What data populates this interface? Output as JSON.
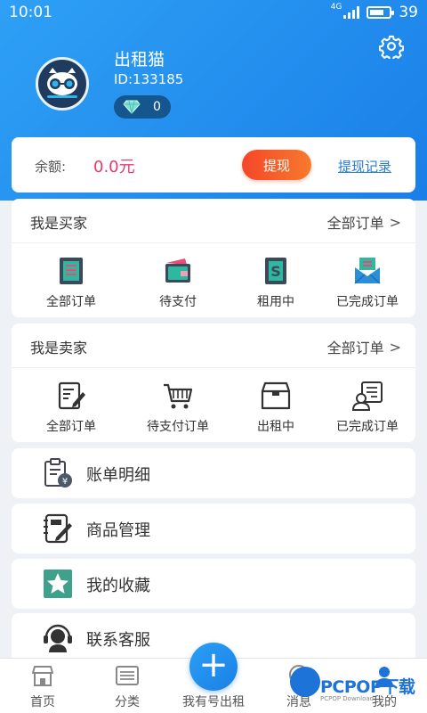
{
  "status_bar": {
    "time": "10:01",
    "network": "4G",
    "battery": "39"
  },
  "profile": {
    "name": "出租猫",
    "id_text": "ID:133185",
    "diamonds": "0"
  },
  "balance": {
    "label": "余额:",
    "value": "0.0元",
    "withdraw_label": "提现",
    "record_label": "提现记录"
  },
  "buyer": {
    "title": "我是买家",
    "all_label": "全部订单",
    "items": [
      {
        "label": "全部订单",
        "icon": "all-orders-icon"
      },
      {
        "label": "待支付",
        "icon": "wallet-icon"
      },
      {
        "label": "租用中",
        "icon": "renting-icon"
      },
      {
        "label": "已完成订单",
        "icon": "completed-icon"
      }
    ]
  },
  "seller": {
    "title": "我是卖家",
    "all_label": "全部订单",
    "items": [
      {
        "label": "全部订单",
        "icon": "edit-doc-icon"
      },
      {
        "label": "待支付订单",
        "icon": "cart-icon"
      },
      {
        "label": "出租中",
        "icon": "box-icon"
      },
      {
        "label": "已完成订单",
        "icon": "user-doc-icon"
      }
    ]
  },
  "menu": [
    {
      "label": "账单明细",
      "icon": "bill-icon"
    },
    {
      "label": "商品管理",
      "icon": "goods-manage-icon"
    },
    {
      "label": "我的收藏",
      "icon": "star-icon"
    },
    {
      "label": "联系客服",
      "icon": "headset-icon"
    }
  ],
  "tabs": [
    {
      "label": "首页",
      "icon": "home-icon"
    },
    {
      "label": "分类",
      "icon": "category-icon"
    },
    {
      "label": "我有号出租",
      "icon": "plus-icon"
    },
    {
      "label": "消息",
      "icon": "message-icon"
    },
    {
      "label": "我的",
      "icon": "user-icon"
    }
  ],
  "watermark": {
    "text": "PCPOP下载",
    "sub": "PCPOP Download"
  },
  "colors": {
    "header": "#1a7fe8",
    "accent_red": "#f5462a",
    "balance": "#e63b6a",
    "link": "#2a7cd6"
  }
}
